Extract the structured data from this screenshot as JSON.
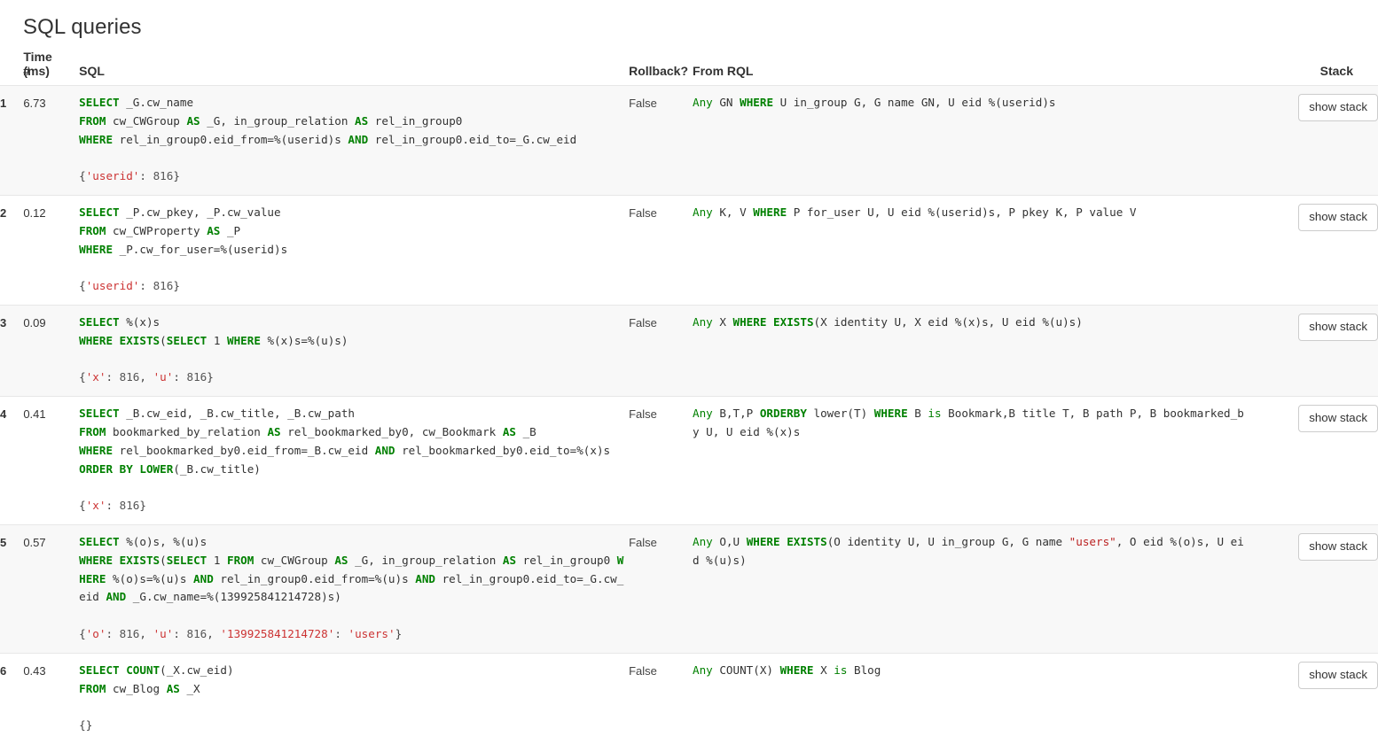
{
  "page": {
    "title": "SQL queries"
  },
  "table": {
    "columns": {
      "num": "#",
      "time": "Time (ms)",
      "sql": "SQL",
      "rollback": "Rollback?",
      "rql": "From RQL",
      "stack": "Stack"
    },
    "stack_button_label": "show stack",
    "rows": [
      {
        "num": "1",
        "time": "6.73",
        "rollback": "False",
        "sql_text": "SELECT _G.cw_name\nFROM cw_CWGroup AS _G, in_group_relation AS rel_in_group0\nWHERE rel_in_group0.eid_from=%(userid)s AND rel_in_group0.eid_to=_G.cw_eid",
        "params_text": "{'userid': 816}",
        "rql_text": "Any GN WHERE U in_group G, G name GN, U eid %(userid)s"
      },
      {
        "num": "2",
        "time": "0.12",
        "rollback": "False",
        "sql_text": "SELECT _P.cw_pkey, _P.cw_value\nFROM cw_CWProperty AS _P\nWHERE _P.cw_for_user=%(userid)s",
        "params_text": "{'userid': 816}",
        "rql_text": "Any K, V WHERE P for_user U, U eid %(userid)s, P pkey K, P value V"
      },
      {
        "num": "3",
        "time": "0.09",
        "rollback": "False",
        "sql_text": "SELECT %(x)s\nWHERE EXISTS(SELECT 1 WHERE %(x)s=%(u)s)",
        "params_text": "{'x': 816, 'u': 816}",
        "rql_text": "Any X WHERE EXISTS(X identity U, X eid %(x)s, U eid %(u)s)"
      },
      {
        "num": "4",
        "time": "0.41",
        "rollback": "False",
        "sql_text": "SELECT _B.cw_eid, _B.cw_title, _B.cw_path\nFROM bookmarked_by_relation AS rel_bookmarked_by0, cw_Bookmark AS _B\nWHERE rel_bookmarked_by0.eid_from=_B.cw_eid AND rel_bookmarked_by0.eid_to=%(x)s\nORDER BY LOWER(_B.cw_title)",
        "params_text": "{'x': 816}",
        "rql_text": "Any B,T,P ORDERBY lower(T) WHERE B is Bookmark,B title T, B path P, B bookmarked_by U, U eid %(x)s"
      },
      {
        "num": "5",
        "time": "0.57",
        "rollback": "False",
        "sql_text": "SELECT %(o)s, %(u)s\nWHERE EXISTS(SELECT 1 FROM cw_CWGroup AS _G, in_group_relation AS rel_in_group0 WHERE %(o)s=%(u)s AND rel_in_group0.eid_from=%(u)s AND rel_in_group0.eid_to=_G.cw_eid AND _G.cw_name=%(139925841214728)s)",
        "params_text": "{'o': 816, 'u': 816, '139925841214728': 'users'}",
        "rql_text": "Any O,U WHERE EXISTS(O identity U, U in_group G, G name \"users\", O eid %(o)s, U eid %(u)s)"
      },
      {
        "num": "6",
        "time": "0.43",
        "rollback": "False",
        "sql_text": "SELECT COUNT(_X.cw_eid)\nFROM cw_Blog AS _X",
        "params_text": "{}",
        "rql_text": "Any COUNT(X) WHERE X is Blog"
      }
    ]
  },
  "colors": {
    "keyword_green": "#008000",
    "string_red": "#bb2222",
    "param_string_red": "#cc3333",
    "row_stripe": "#f8f8f8",
    "row_border": "#e7e7e7",
    "text": "#333333",
    "button_border": "#cccccc"
  }
}
